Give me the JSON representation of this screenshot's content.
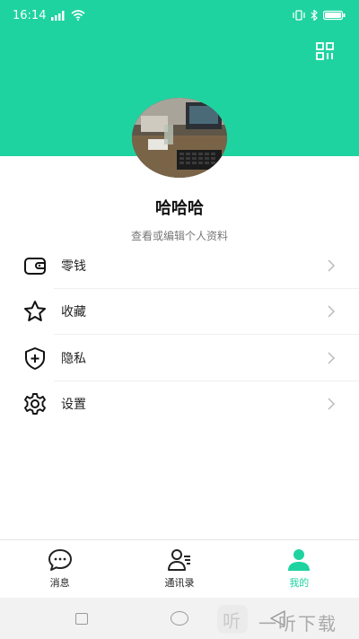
{
  "status_bar": {
    "time": "16:14"
  },
  "profile": {
    "username": "哈哈哈",
    "subtitle": "查看或编辑个人资料"
  },
  "menu": {
    "items": [
      {
        "label": "零钱",
        "icon": "wallet-icon"
      },
      {
        "label": "收藏",
        "icon": "star-icon"
      },
      {
        "label": "隐私",
        "icon": "shield-plus-icon"
      },
      {
        "label": "设置",
        "icon": "gear-icon"
      }
    ]
  },
  "tabbar": {
    "tabs": [
      {
        "label": "消息",
        "icon": "chat-bubble-icon",
        "active": false
      },
      {
        "label": "通讯录",
        "icon": "contacts-icon",
        "active": false
      },
      {
        "label": "我的",
        "icon": "person-icon",
        "active": true
      }
    ]
  },
  "watermark": {
    "text": "一听下载"
  },
  "colors": {
    "accent": "#1fd3a0",
    "text": "#222222",
    "muted": "#777777"
  }
}
